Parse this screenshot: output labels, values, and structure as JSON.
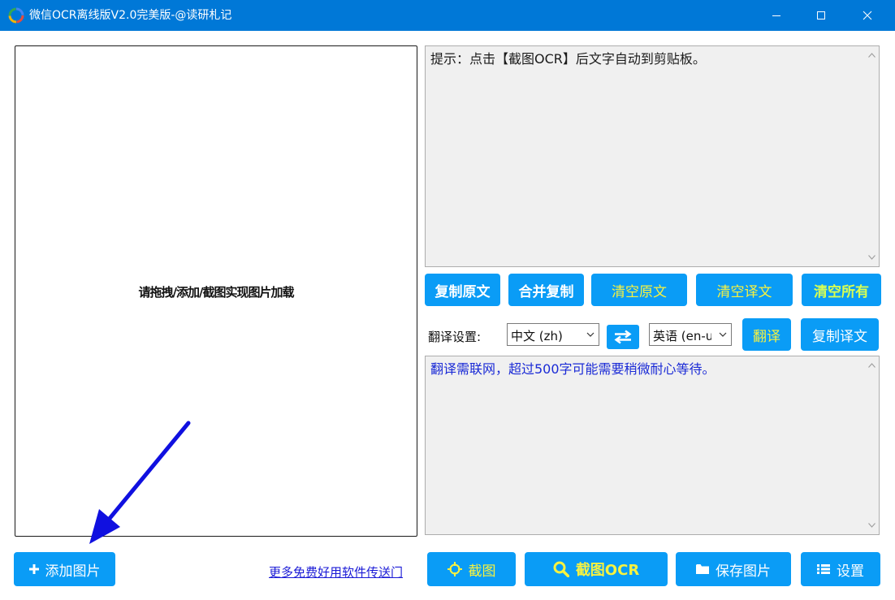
{
  "window": {
    "title": "微信OCR离线版V2.0完美版-@读研札记",
    "icons": {
      "minimize": "minimize-icon",
      "maximize": "maximize-icon",
      "close": "close-icon"
    }
  },
  "image_panel": {
    "placeholder": "请拖拽/添加/截图实现图片加载"
  },
  "ocr_text": {
    "content": "提示：点击【截图OCR】后文字自动到剪贴板。"
  },
  "actions": {
    "copy_original": "复制原文",
    "merge_copy": "合并复制",
    "clear_original": "清空原文",
    "clear_translation": "清空译文",
    "clear_all": "清空所有"
  },
  "translate": {
    "label": "翻译设置:",
    "source_lang": "中文 (zh)",
    "target_lang": "英语 (en-us)",
    "translate_button": "翻译",
    "copy_translation": "复制译文",
    "result": "翻译需联网，超过500字可能需要稍微耐心等待。"
  },
  "bottom_bar": {
    "add_image": "添加图片",
    "more_link": "更多免费好用软件传送门",
    "capture": "截图",
    "capture_ocr": "截图OCR",
    "save_image": "保存图片",
    "settings": "设置"
  },
  "colors": {
    "titlebar": "#0078d7",
    "button": "#0a9cf6",
    "highlight_text": "#f7f240",
    "translation_text": "#1a2ad6",
    "annotation_arrow": "#1010e0"
  }
}
